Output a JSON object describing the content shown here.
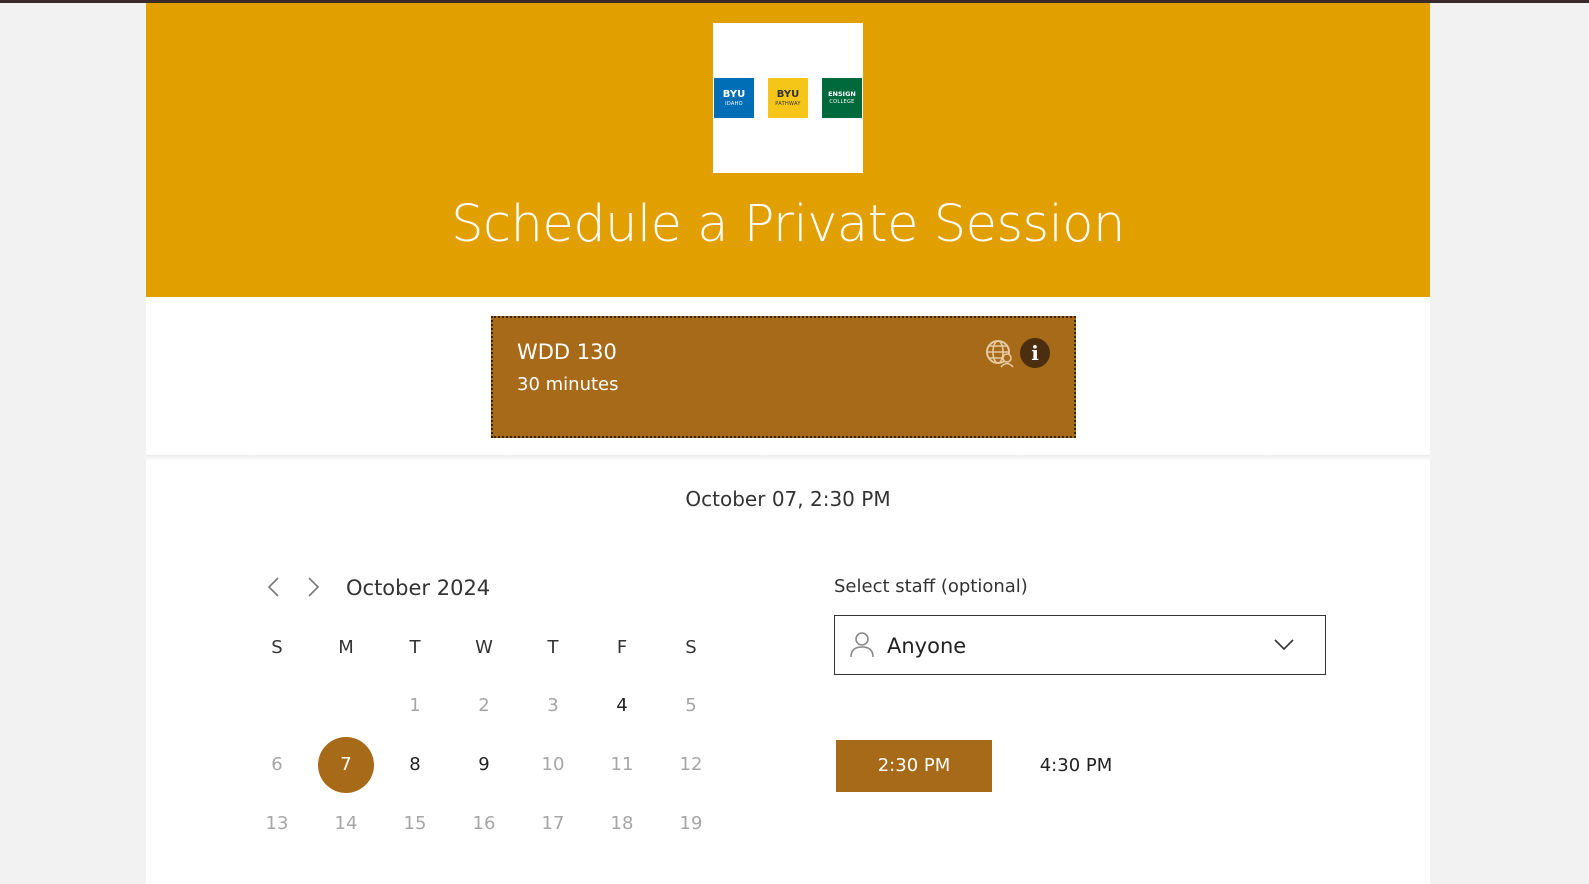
{
  "header": {
    "logos": [
      {
        "name": "byu-idaho-logo",
        "line1": "BYU",
        "line2": "IDAHO",
        "color": "#006eb6"
      },
      {
        "name": "byu-pathway-logo",
        "line1": "BYU",
        "line2": "PATHWAY",
        "color": "#f5c518"
      },
      {
        "name": "ensign-college-logo",
        "line1": "ENSIGN",
        "line2": "COLLEGE",
        "color": "#006a3c"
      }
    ],
    "title": "Schedule a Private Session",
    "banner_color": "#e19f00"
  },
  "service": {
    "name": "WDD 130",
    "duration": "30 minutes",
    "color": "#a66a19",
    "icons": [
      "globe-person-icon",
      "info-icon"
    ],
    "info_glyph": "i"
  },
  "selection": {
    "datetime": "October 07, 2:30 PM"
  },
  "calendar": {
    "month_label": "October 2024",
    "weekdays": [
      "S",
      "M",
      "T",
      "W",
      "T",
      "F",
      "S"
    ],
    "weeks": [
      [
        "",
        "",
        "1",
        "2",
        "3",
        "4",
        "5"
      ],
      [
        "6",
        "7",
        "8",
        "9",
        "10",
        "11",
        "12"
      ],
      [
        "13",
        "14",
        "15",
        "16",
        "17",
        "18",
        "19"
      ]
    ],
    "available_days": [
      "4",
      "7",
      "8",
      "9"
    ],
    "selected_day": "7"
  },
  "staff": {
    "label": "Select staff (optional)",
    "value": "Anyone"
  },
  "time_slots": {
    "selected": "2:30 PM",
    "other": "4:30 PM"
  }
}
